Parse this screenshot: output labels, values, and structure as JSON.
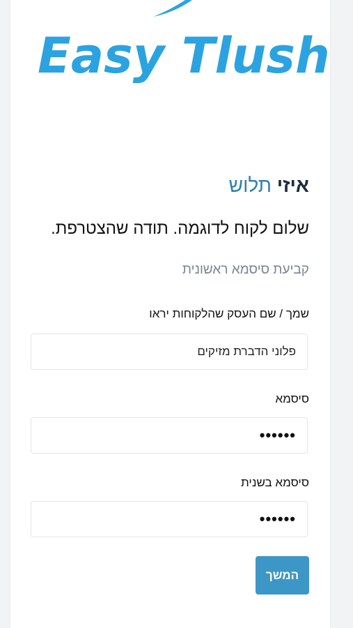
{
  "logo": {
    "text": "Easy Tlush"
  },
  "brand": {
    "part1": "איזי",
    "part2": "תלוש"
  },
  "greeting": "שלום לקוח לדוגמה. תודה שהצטרפת.",
  "subtitle": "קביעת סיסמא ראשונית",
  "form": {
    "business_name_label": "שמך / שם העסק שהלקוחות יראו",
    "business_name_value": "פלוני הדברת מזיקים",
    "password_label": "סיסמא",
    "password_value": "••••••",
    "password_confirm_label": "סיסמא בשנית",
    "password_confirm_value": "••••••",
    "submit_label": "המשך"
  },
  "colors": {
    "brand_blue": "#2ba3e0",
    "button": "#3c97c7",
    "page_bg": "#f2f3f5"
  }
}
